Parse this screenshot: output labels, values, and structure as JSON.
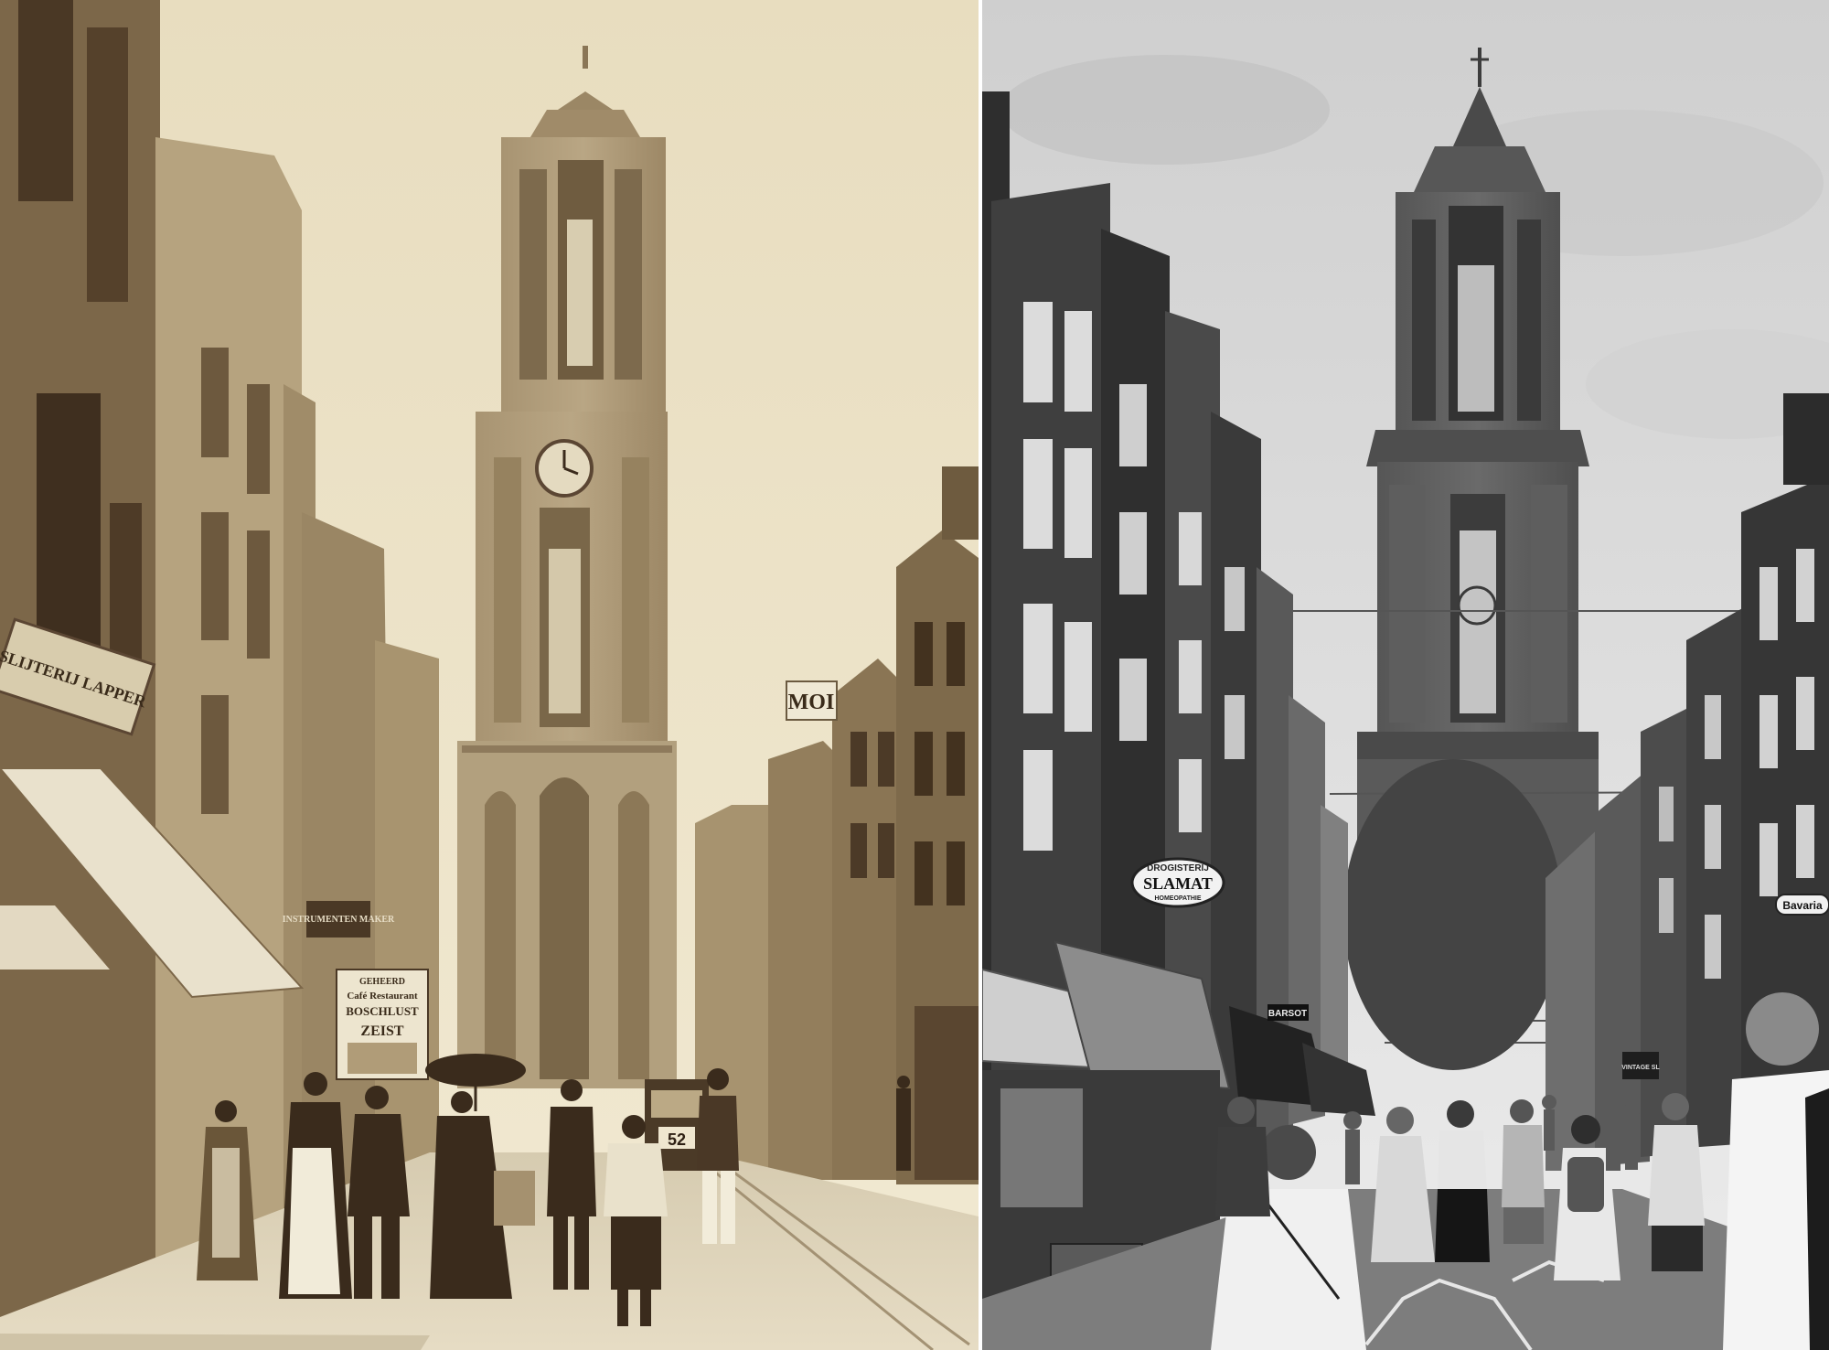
{
  "scene": {
    "left_panel": {
      "tone": "sepia",
      "colors": {
        "sky": "#ece3c8",
        "building_dark": "#5b4633",
        "building_mid": "#8e7a60",
        "building_light": "#c9b998",
        "street": "#d9cfb6"
      },
      "signs": {
        "shop_sign": "SLIJTERIJ LAPPER",
        "moi_sign": "MOI",
        "poster_top": "GEHEERD",
        "poster_line1": "Café Restaurant",
        "poster_line2": "BOSCHLUST",
        "poster_line3": "ZEIST",
        "instrument_sign": "INSTRUMENTEN\nMAKER",
        "tram_number": "52"
      }
    },
    "right_panel": {
      "tone": "grayscale",
      "colors": {
        "sky": "#d6d6d6",
        "building_dark": "#3a3a3a",
        "building_mid": "#6e6e6e",
        "building_light": "#bdbdbd",
        "street": "#8a8a8a"
      },
      "signs": {
        "drogisterij_top": "DROGISTERIJ",
        "drogisterij_main": "SLAMAT",
        "drogisterij_sub": "HOMEOPATHIE",
        "barsot_sign": "BARSOT",
        "bavaria_sign": "Bavaria",
        "vintage_sign": "VINTAGE SL"
      }
    }
  }
}
